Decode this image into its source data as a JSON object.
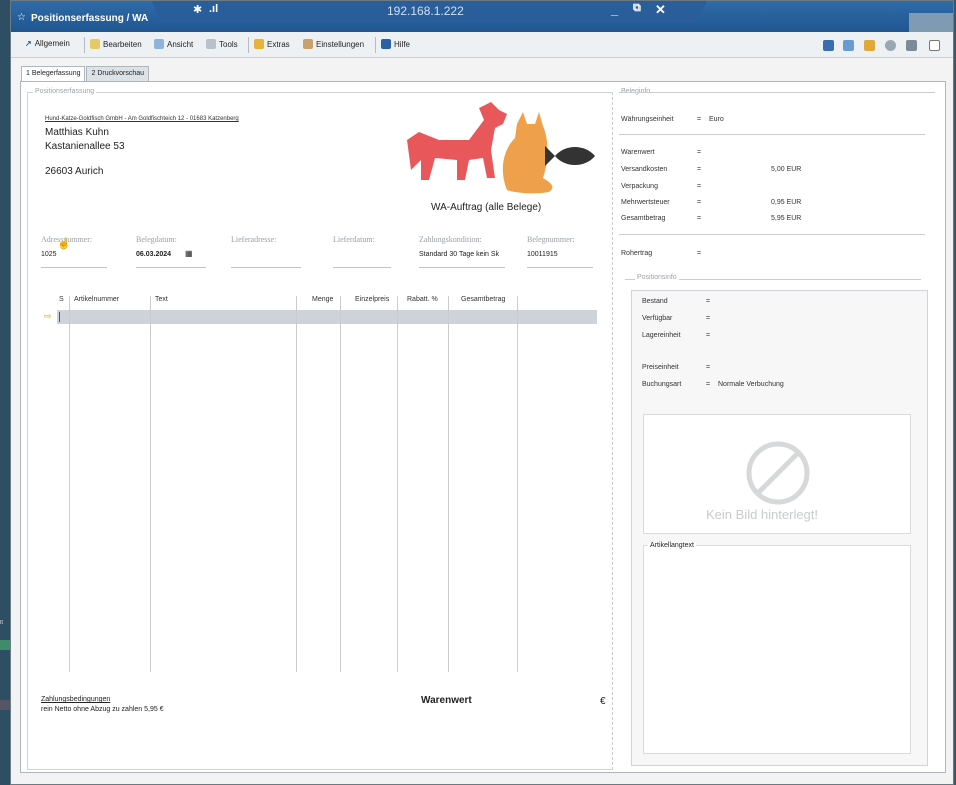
{
  "window": {
    "title": "Positionserfassung / WA",
    "remote_ip": "192.168.1.222"
  },
  "menu": {
    "items": [
      {
        "label": "Allgemein",
        "icon": "arrow-icon"
      },
      {
        "label": "Bearbeiten",
        "icon": "edit-icon"
      },
      {
        "label": "Ansicht",
        "icon": "view-icon"
      },
      {
        "label": "Tools",
        "icon": "tools-icon"
      },
      {
        "label": "Extras",
        "icon": "extras-icon"
      },
      {
        "label": "Einstellungen",
        "icon": "settings-icon"
      },
      {
        "label": "Hilfe",
        "icon": "help-icon"
      }
    ]
  },
  "tabs": [
    {
      "label": "1 Belegerfassung",
      "active": true
    },
    {
      "label": "2 Druckvorschau",
      "active": false
    }
  ],
  "positionserfassung": {
    "legend": "Positionserfassung",
    "sender_line": "Hund-Katze-Goldfisch GmbH - Am Goldfischteich 12 - 01683 Katzenberg",
    "recipient": {
      "name": "Matthias Kuhn",
      "street": "Kastanienallee 53",
      "city": "26603 Aurich"
    },
    "doc_title": "WA-Auftrag (alle Belege)",
    "fields": [
      {
        "label": "Adressnummer:",
        "value": "1025"
      },
      {
        "label": "Belegdatum:",
        "value": "06.03.2024"
      },
      {
        "label": "Lieferadresse:",
        "value": ""
      },
      {
        "label": "Lieferdatum:",
        "value": ""
      },
      {
        "label": "Zahlungskondition:",
        "value": "Standard 30 Tage kein Sk"
      },
      {
        "label": "Belegnummer:",
        "value": "10011915"
      }
    ],
    "table": {
      "columns": [
        "S",
        "Artikelnummer",
        "Text",
        "Menge",
        "Einzelpreis",
        "Rabatt. %",
        "Gesamtbetrag"
      ]
    },
    "footer": {
      "terms_title": "Zahlungsbedingungen",
      "terms_text": "rein Netto ohne Abzug zu zahlen 5,95 €",
      "summary_label": "Warenwert",
      "currency": "€"
    }
  },
  "beleginfo": {
    "legend": "Beleginfo",
    "currency_label": "Währungseinheit",
    "currency_value": "Euro",
    "rows": [
      {
        "label": "Warenwert",
        "value": ""
      },
      {
        "label": "Versandkosten",
        "value": "5,00 EUR"
      },
      {
        "label": "Verpackung",
        "value": ""
      },
      {
        "label": "Mehrwertsteuer",
        "value": "0,95 EUR"
      },
      {
        "label": "Gesamtbetrag",
        "value": "5,95 EUR"
      }
    ],
    "rohertrag_label": "Rohertrag",
    "sep": "="
  },
  "positionsinfo": {
    "legend": "Positionsinfo",
    "rows": [
      {
        "label": "Bestand",
        "value": ""
      },
      {
        "label": "Verfügbar",
        "value": ""
      },
      {
        "label": "Lagereinheit",
        "value": ""
      }
    ],
    "rows2": [
      {
        "label": "Preiseinheit",
        "value": ""
      },
      {
        "label": "Buchungsart",
        "value": "Normale Verbuchung"
      }
    ],
    "no_image": "Kein Bild hinterlegt!",
    "longtext_label": "Artikellangtext"
  },
  "colors": {
    "title_bar": "#2f6ca8",
    "dog": "#e8585a",
    "cat": "#eea04a",
    "fish": "#333333"
  }
}
